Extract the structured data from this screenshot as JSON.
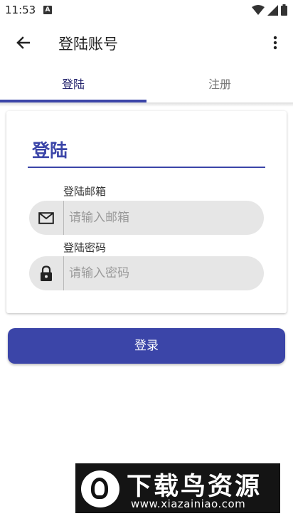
{
  "status_bar": {
    "time": "11:53",
    "notification_icon_letter": "A",
    "icons": [
      "wifi-icon",
      "signal-icon",
      "battery-icon"
    ]
  },
  "app_bar": {
    "title": "登陆账号",
    "back_icon": "arrow-left-icon",
    "more_icon": "more-vertical-icon"
  },
  "tabs": [
    {
      "label": "登陆",
      "selected": true
    },
    {
      "label": "注册",
      "selected": false
    }
  ],
  "login_card": {
    "title": "登陆",
    "email": {
      "label": "登陆邮箱",
      "placeholder": "请输入邮箱",
      "value": "",
      "icon": "mail-icon"
    },
    "password": {
      "label": "登陆密码",
      "placeholder": "请输入密码",
      "value": "",
      "icon": "lock-icon"
    }
  },
  "login_button": {
    "label": "登录"
  },
  "watermark": {
    "title": "下载鸟资源",
    "url": "www.xiazainiao.com"
  },
  "colors": {
    "primary": "#3b45a8",
    "input_background": "#e6e6e6",
    "watermark_background": "#141414"
  }
}
